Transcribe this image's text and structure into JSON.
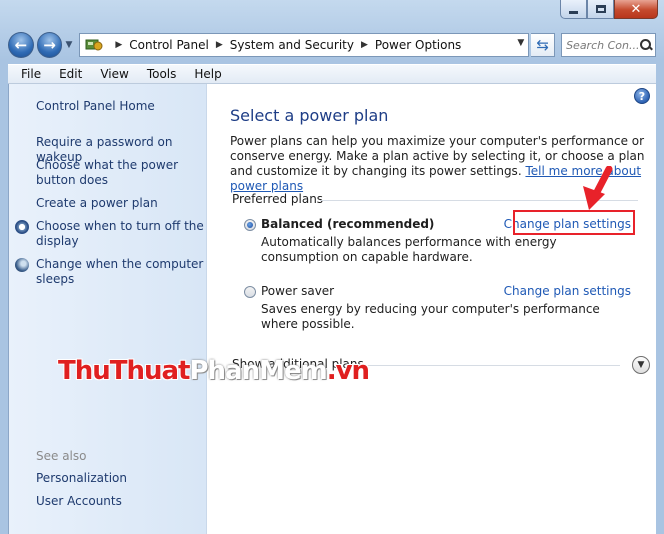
{
  "window": {
    "caption": {
      "minimize": "minimize",
      "maximize": "maximize",
      "close": "✕"
    }
  },
  "address": {
    "crumbs": [
      "Control Panel",
      "System and Security",
      "Power Options"
    ],
    "search_placeholder": "Search Con..."
  },
  "menu": [
    "File",
    "Edit",
    "View",
    "Tools",
    "Help"
  ],
  "sidebar": {
    "home": "Control Panel Home",
    "links": [
      "Require a password on wakeup",
      "Choose what the power button does",
      "Create a power plan",
      "Choose when to turn off the display",
      "Change when the computer sleeps"
    ],
    "see_also": "See also",
    "see_also_links": [
      "Personalization",
      "User Accounts"
    ]
  },
  "watermark": {
    "part1": "ThuThuat",
    "part2": "PhanMem",
    "part3": ".vn"
  },
  "main": {
    "title": "Select a power plan",
    "intro": "Power plans can help you maximize your computer's performance or conserve energy. Make a plan active by selecting it, or choose a plan and customize it by changing its power settings.",
    "intro_link": "Tell me more about power plans",
    "preferred_label": "Preferred plans",
    "plans": [
      {
        "name": "Balanced (recommended)",
        "description": "Automatically balances performance with energy consumption on capable hardware.",
        "link": "Change plan settings",
        "selected": true
      },
      {
        "name": "Power saver",
        "description": "Saves energy by reducing your computer's performance where possible.",
        "link": "Change plan settings",
        "selected": false
      }
    ],
    "show_additional": "Show additional plans",
    "help": "?"
  },
  "colors": {
    "accent_link": "#1f59b5",
    "title": "#1e3d86",
    "highlight": "#e8222a"
  }
}
